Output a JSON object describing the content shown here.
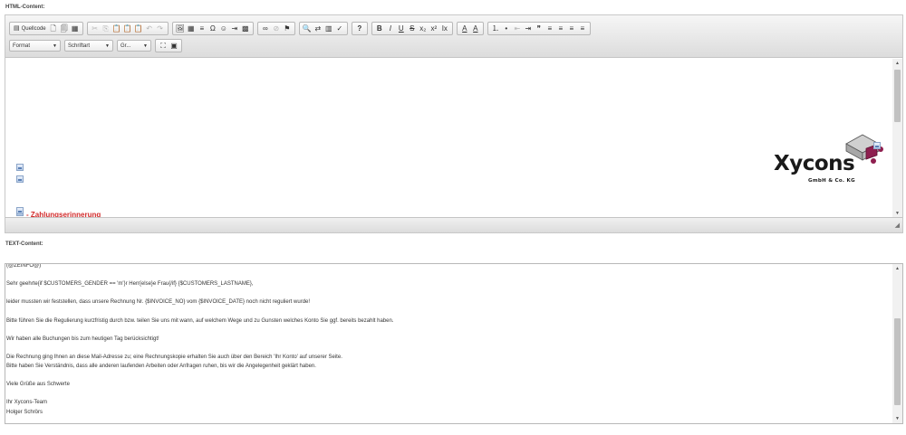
{
  "labels": {
    "html_content": "HTML-Content:",
    "text_content": "TEXT-Content:"
  },
  "toolbar": {
    "source_label": "Quellcode",
    "row1_icons": [
      {
        "name": "source-icon",
        "glyph": "▤"
      },
      {
        "name": "new-page-icon",
        "glyph": "🗋"
      },
      {
        "name": "preview-icon",
        "glyph": "🗐"
      },
      {
        "name": "templates-icon",
        "glyph": "▦"
      },
      {
        "name": "cut-icon",
        "glyph": "✂"
      },
      {
        "name": "copy-icon",
        "glyph": "⎘"
      },
      {
        "name": "paste-icon",
        "glyph": "📋"
      },
      {
        "name": "paste-text-icon",
        "glyph": "📋"
      },
      {
        "name": "paste-word-icon",
        "glyph": "📋"
      },
      {
        "name": "undo-icon",
        "glyph": "↶"
      },
      {
        "name": "redo-icon",
        "glyph": "↷"
      },
      {
        "name": "image-icon",
        "glyph": "🖼"
      },
      {
        "name": "table-icon",
        "glyph": "▦"
      },
      {
        "name": "horizontal-rule-icon",
        "glyph": "≡"
      },
      {
        "name": "special-char-icon",
        "glyph": "Ω"
      },
      {
        "name": "smiley-icon",
        "glyph": "☺"
      },
      {
        "name": "page-break-icon",
        "glyph": "⇥"
      },
      {
        "name": "iframe-icon",
        "glyph": "▩"
      },
      {
        "name": "link-icon",
        "glyph": "∞"
      },
      {
        "name": "unlink-icon",
        "glyph": "⊘"
      },
      {
        "name": "anchor-icon",
        "glyph": "⚑"
      },
      {
        "name": "find-icon",
        "glyph": "🔍"
      },
      {
        "name": "replace-icon",
        "glyph": "⇄"
      },
      {
        "name": "select-all-icon",
        "glyph": "▥"
      },
      {
        "name": "spellcheck-icon",
        "glyph": "✓"
      },
      {
        "name": "about-icon",
        "glyph": "?"
      },
      {
        "name": "bold-icon",
        "glyph": "B"
      },
      {
        "name": "italic-icon",
        "glyph": "I"
      },
      {
        "name": "underline-icon",
        "glyph": "U"
      },
      {
        "name": "strike-icon",
        "glyph": "S"
      },
      {
        "name": "subscript-icon",
        "glyph": "x₂"
      },
      {
        "name": "superscript-icon",
        "glyph": "x²"
      },
      {
        "name": "remove-format-icon",
        "glyph": "Ix"
      },
      {
        "name": "text-color-icon",
        "glyph": "A"
      },
      {
        "name": "bg-color-icon",
        "glyph": "A"
      },
      {
        "name": "numbered-list-icon",
        "glyph": "⒈"
      },
      {
        "name": "bulleted-list-icon",
        "glyph": "•"
      },
      {
        "name": "outdent-icon",
        "glyph": "⇤"
      },
      {
        "name": "indent-icon",
        "glyph": "⇥"
      },
      {
        "name": "blockquote-icon",
        "glyph": "❞"
      },
      {
        "name": "align-left-icon",
        "glyph": "≡"
      },
      {
        "name": "align-center-icon",
        "glyph": "≡"
      },
      {
        "name": "align-right-icon",
        "glyph": "≡"
      },
      {
        "name": "justify-icon",
        "glyph": "≡"
      }
    ],
    "format_label": "Format",
    "font_label": "Schriftart",
    "size_label": "Gr...",
    "maximize_glyph": "⛶",
    "show_blocks_glyph": "▣"
  },
  "editor": {
    "reminder_text": "- Zahlungserinnerung",
    "logo_text": "Xycons",
    "logo_subtext": "GmbH & Co. KG"
  },
  "text_content": {
    "lines": [
      "(@ZEINFO@)",
      "",
      "Sehr geehrte{if $CUSTOMERS_GENDER == 'm'}r Herr{else}e Frau{/if} {$CUSTOMERS_LASTNAME},",
      "",
      "leider mussten wir feststellen, dass unsere Rechnung Nr. {$INVOICE_NO} vom {$INVOICE_DATE} noch nicht reguliert wurde!",
      "",
      "Bitte führen Sie die Regulierung kurzfristig durch bzw. teilen Sie uns mit wann, auf welchem Wege und zu Gunsten welches Konto Sie ggf. bereits bezahlt haben.",
      "",
      "Wir haben alle Buchungen bis zum heutigen Tag berücksichtigt!",
      "",
      "Die Rechnung ging Ihnen an diese Mail-Adresse zu; eine Rechnungskopie erhalten Sie auch über den Bereich 'Ihr Konto' auf unserer Seite.",
      "Bitte haben Sie Verständnis, dass alle anderen laufenden Arbeiten oder Anfragen ruhen, bis wir die Angelegenheit geklärt haben.",
      "",
      "Viele Grüße aus Schwerte",
      "",
      "Ihr Xycons-Team",
      "Holger Schrörs"
    ]
  }
}
